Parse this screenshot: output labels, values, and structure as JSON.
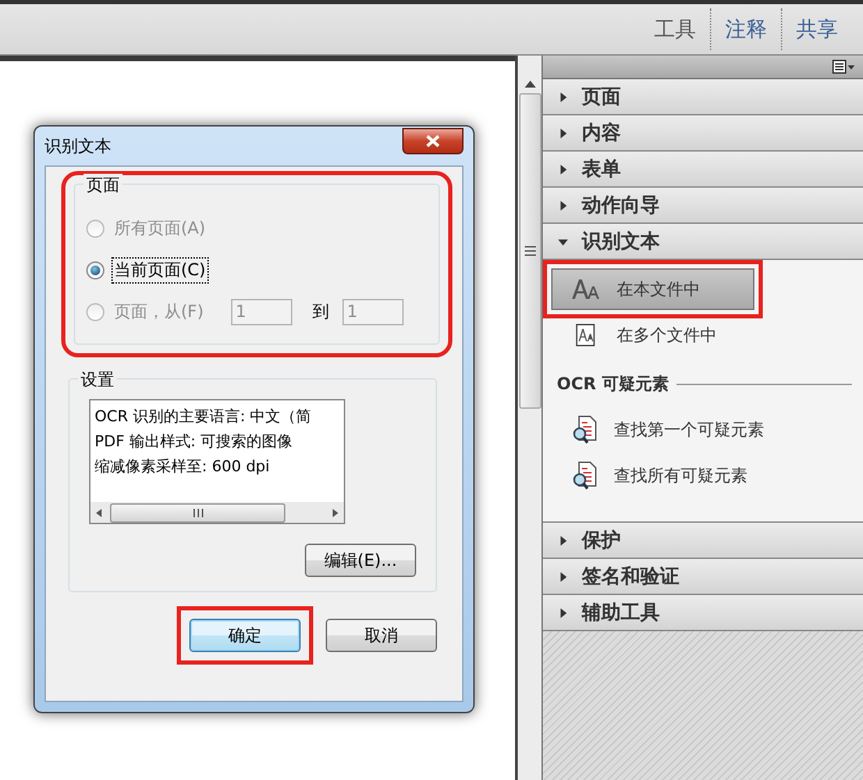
{
  "toolbar": [
    {
      "label": "工具",
      "selected": true
    },
    {
      "label": "注释",
      "selected": false
    },
    {
      "label": "共享",
      "selected": false
    }
  ],
  "panel": {
    "sections": [
      {
        "title": "页面",
        "expanded": false
      },
      {
        "title": "内容",
        "expanded": false
      },
      {
        "title": "表单",
        "expanded": false
      },
      {
        "title": "动作向导",
        "expanded": false
      },
      {
        "title": "识别文本",
        "expanded": true,
        "items": [
          {
            "label": "在本文件中",
            "selected": true,
            "highlighted": true
          },
          {
            "label": "在多个文件中",
            "selected": false,
            "highlighted": false
          }
        ],
        "group": {
          "title": "OCR 可疑元素",
          "items": [
            {
              "label": "查找第一个可疑元素"
            },
            {
              "label": "查找所有可疑元素"
            }
          ]
        }
      },
      {
        "title": "保护",
        "expanded": false
      },
      {
        "title": "签名和验证",
        "expanded": false
      },
      {
        "title": "辅助工具",
        "expanded": false
      }
    ]
  },
  "dialog": {
    "title": "识别文本",
    "pages": {
      "title": "页面",
      "highlighted": true,
      "options": [
        {
          "kind": "plain",
          "label": "所有页面(A)",
          "selected": false,
          "disabled": true,
          "focused": false
        },
        {
          "kind": "plain",
          "label": "当前页面(C)",
          "selected": true,
          "disabled": false,
          "focused": true
        },
        {
          "kind": "range",
          "label": "页面，从(F)",
          "selected": false,
          "disabled": true,
          "focused": false,
          "from": "1",
          "to_label": "到",
          "to": "1"
        }
      ]
    },
    "settings": {
      "title": "设置",
      "lines": [
        "OCR 识别的主要语言: 中文（简",
        "PDF 输出样式: 可搜索的图像",
        "缩减像素采样至: 600 dpi"
      ],
      "edit_button": "编辑(E)..."
    },
    "buttons": [
      {
        "label": "确定",
        "default": true,
        "highlighted": true
      },
      {
        "label": "取消",
        "default": false,
        "highlighted": false
      }
    ]
  }
}
